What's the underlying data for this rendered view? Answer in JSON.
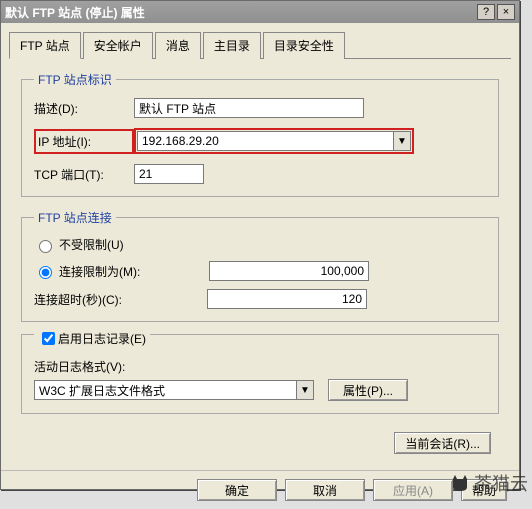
{
  "window": {
    "title": "默认 FTP 站点 (停止) 属性",
    "help_icon": "?",
    "close_icon": "×"
  },
  "tabs": {
    "t0": "FTP 站点",
    "t1": "安全帐户",
    "t2": "消息",
    "t3": "主目录",
    "t4": "目录安全性"
  },
  "groups": {
    "identity": {
      "legend": "FTP 站点标识",
      "desc_label": "描述(D):",
      "desc_value": "默认 FTP 站点",
      "ip_label": "IP 地址(I):",
      "ip_value": "192.168.29.20",
      "port_label": "TCP 端口(T):",
      "port_value": "21"
    },
    "connection": {
      "legend": "FTP 站点连接",
      "unlimited_label": "不受限制(U)",
      "limit_label": "连接限制为(M):",
      "limit_value": "100,000",
      "timeout_label": "连接超时(秒)(C):",
      "timeout_value": "120"
    },
    "logging": {
      "enable_label": "启用日志记录(E)",
      "format_label": "活动日志格式(V):",
      "format_value": "W3C 扩展日志文件格式",
      "props_btn": "属性(P)..."
    }
  },
  "buttons": {
    "current_session": "当前会话(R)...",
    "ok": "确定",
    "cancel": "取消",
    "apply": "应用(A)",
    "help": "帮助"
  },
  "watermark": "茶猫云"
}
